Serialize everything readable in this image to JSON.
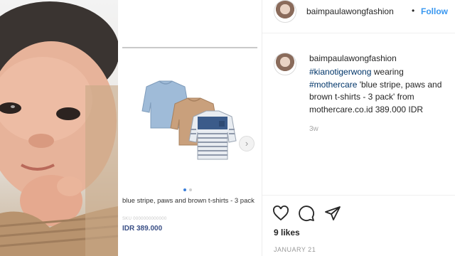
{
  "post": {
    "username": "baimpaulawongfashion",
    "bullet": "•",
    "follow_label": "Follow",
    "caption": {
      "username": "baimpaulawongfashion",
      "line1_tag": "#kianotigerwong",
      "line1_rest": " wearing",
      "line2_tag": "#mothercare",
      "line2_rest": " 'blue stripe, paws and",
      "line3": "brown t-shirts - 3 pack' from",
      "line4": "mothercare.co.id 389.000 IDR"
    },
    "time_ago": "3w",
    "likes": "9 likes",
    "date": "JANUARY 21"
  },
  "product": {
    "title": "blue stripe, paws and brown t-shirts - 3 pack",
    "sku": "SKU 0000000000000",
    "price": "IDR 389.000",
    "carousel_index": 0,
    "carousel_count": 2
  },
  "icons": {
    "like": "heart-icon",
    "comment": "comment-icon",
    "share": "share-icon",
    "next": "chevron-right-icon"
  },
  "colors": {
    "follow": "#3897f0",
    "hashtag": "#003569",
    "price": "#3a4f86"
  }
}
